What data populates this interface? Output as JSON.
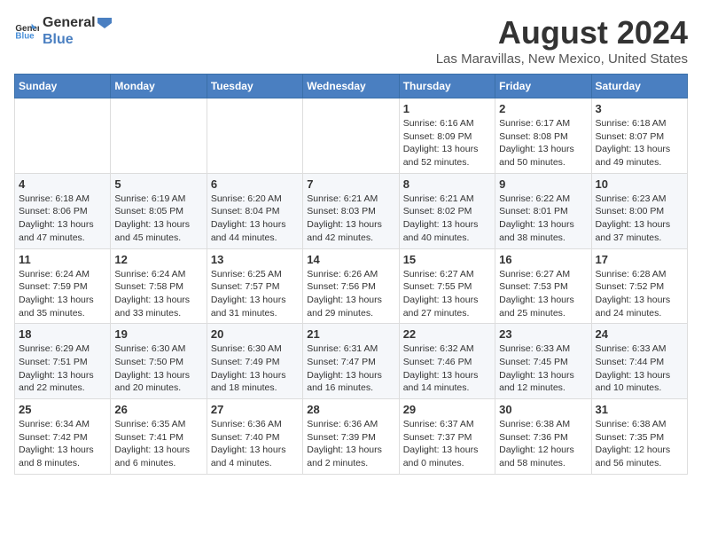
{
  "logo": {
    "text_general": "General",
    "text_blue": "Blue"
  },
  "header": {
    "title": "August 2024",
    "subtitle": "Las Maravillas, New Mexico, United States"
  },
  "weekdays": [
    "Sunday",
    "Monday",
    "Tuesday",
    "Wednesday",
    "Thursday",
    "Friday",
    "Saturday"
  ],
  "weeks": [
    [
      {
        "day": "",
        "info": ""
      },
      {
        "day": "",
        "info": ""
      },
      {
        "day": "",
        "info": ""
      },
      {
        "day": "",
        "info": ""
      },
      {
        "day": "1",
        "info": "Sunrise: 6:16 AM\nSunset: 8:09 PM\nDaylight: 13 hours\nand 52 minutes."
      },
      {
        "day": "2",
        "info": "Sunrise: 6:17 AM\nSunset: 8:08 PM\nDaylight: 13 hours\nand 50 minutes."
      },
      {
        "day": "3",
        "info": "Sunrise: 6:18 AM\nSunset: 8:07 PM\nDaylight: 13 hours\nand 49 minutes."
      }
    ],
    [
      {
        "day": "4",
        "info": "Sunrise: 6:18 AM\nSunset: 8:06 PM\nDaylight: 13 hours\nand 47 minutes."
      },
      {
        "day": "5",
        "info": "Sunrise: 6:19 AM\nSunset: 8:05 PM\nDaylight: 13 hours\nand 45 minutes."
      },
      {
        "day": "6",
        "info": "Sunrise: 6:20 AM\nSunset: 8:04 PM\nDaylight: 13 hours\nand 44 minutes."
      },
      {
        "day": "7",
        "info": "Sunrise: 6:21 AM\nSunset: 8:03 PM\nDaylight: 13 hours\nand 42 minutes."
      },
      {
        "day": "8",
        "info": "Sunrise: 6:21 AM\nSunset: 8:02 PM\nDaylight: 13 hours\nand 40 minutes."
      },
      {
        "day": "9",
        "info": "Sunrise: 6:22 AM\nSunset: 8:01 PM\nDaylight: 13 hours\nand 38 minutes."
      },
      {
        "day": "10",
        "info": "Sunrise: 6:23 AM\nSunset: 8:00 PM\nDaylight: 13 hours\nand 37 minutes."
      }
    ],
    [
      {
        "day": "11",
        "info": "Sunrise: 6:24 AM\nSunset: 7:59 PM\nDaylight: 13 hours\nand 35 minutes."
      },
      {
        "day": "12",
        "info": "Sunrise: 6:24 AM\nSunset: 7:58 PM\nDaylight: 13 hours\nand 33 minutes."
      },
      {
        "day": "13",
        "info": "Sunrise: 6:25 AM\nSunset: 7:57 PM\nDaylight: 13 hours\nand 31 minutes."
      },
      {
        "day": "14",
        "info": "Sunrise: 6:26 AM\nSunset: 7:56 PM\nDaylight: 13 hours\nand 29 minutes."
      },
      {
        "day": "15",
        "info": "Sunrise: 6:27 AM\nSunset: 7:55 PM\nDaylight: 13 hours\nand 27 minutes."
      },
      {
        "day": "16",
        "info": "Sunrise: 6:27 AM\nSunset: 7:53 PM\nDaylight: 13 hours\nand 25 minutes."
      },
      {
        "day": "17",
        "info": "Sunrise: 6:28 AM\nSunset: 7:52 PM\nDaylight: 13 hours\nand 24 minutes."
      }
    ],
    [
      {
        "day": "18",
        "info": "Sunrise: 6:29 AM\nSunset: 7:51 PM\nDaylight: 13 hours\nand 22 minutes."
      },
      {
        "day": "19",
        "info": "Sunrise: 6:30 AM\nSunset: 7:50 PM\nDaylight: 13 hours\nand 20 minutes."
      },
      {
        "day": "20",
        "info": "Sunrise: 6:30 AM\nSunset: 7:49 PM\nDaylight: 13 hours\nand 18 minutes."
      },
      {
        "day": "21",
        "info": "Sunrise: 6:31 AM\nSunset: 7:47 PM\nDaylight: 13 hours\nand 16 minutes."
      },
      {
        "day": "22",
        "info": "Sunrise: 6:32 AM\nSunset: 7:46 PM\nDaylight: 13 hours\nand 14 minutes."
      },
      {
        "day": "23",
        "info": "Sunrise: 6:33 AM\nSunset: 7:45 PM\nDaylight: 13 hours\nand 12 minutes."
      },
      {
        "day": "24",
        "info": "Sunrise: 6:33 AM\nSunset: 7:44 PM\nDaylight: 13 hours\nand 10 minutes."
      }
    ],
    [
      {
        "day": "25",
        "info": "Sunrise: 6:34 AM\nSunset: 7:42 PM\nDaylight: 13 hours\nand 8 minutes."
      },
      {
        "day": "26",
        "info": "Sunrise: 6:35 AM\nSunset: 7:41 PM\nDaylight: 13 hours\nand 6 minutes."
      },
      {
        "day": "27",
        "info": "Sunrise: 6:36 AM\nSunset: 7:40 PM\nDaylight: 13 hours\nand 4 minutes."
      },
      {
        "day": "28",
        "info": "Sunrise: 6:36 AM\nSunset: 7:39 PM\nDaylight: 13 hours\nand 2 minutes."
      },
      {
        "day": "29",
        "info": "Sunrise: 6:37 AM\nSunset: 7:37 PM\nDaylight: 13 hours\nand 0 minutes."
      },
      {
        "day": "30",
        "info": "Sunrise: 6:38 AM\nSunset: 7:36 PM\nDaylight: 12 hours\nand 58 minutes."
      },
      {
        "day": "31",
        "info": "Sunrise: 6:38 AM\nSunset: 7:35 PM\nDaylight: 12 hours\nand 56 minutes."
      }
    ]
  ]
}
